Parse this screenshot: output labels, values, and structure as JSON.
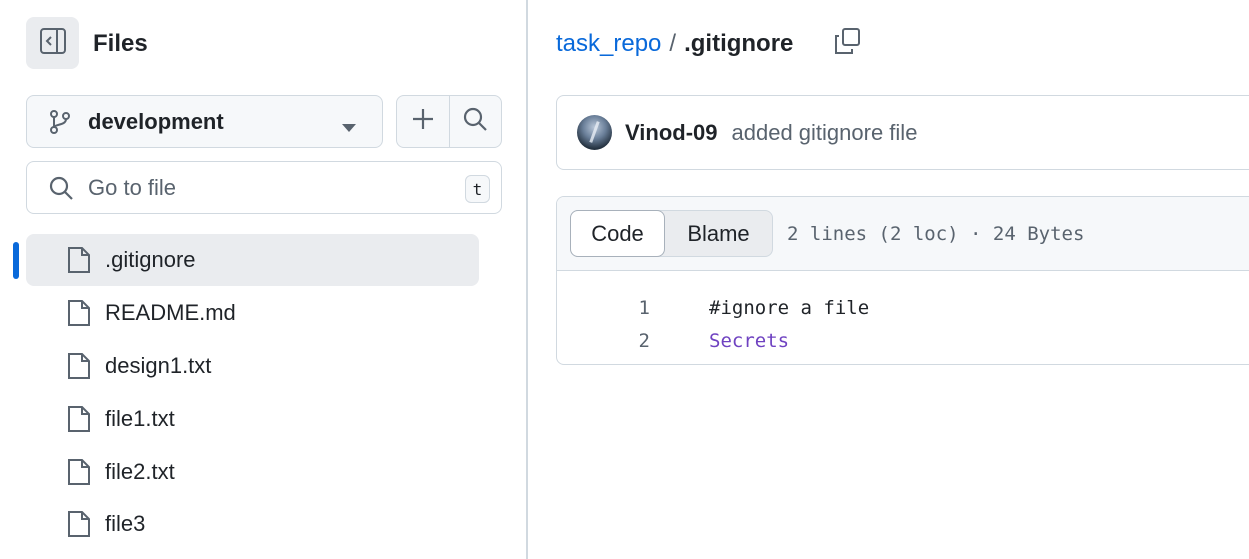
{
  "sidebar": {
    "title": "Files",
    "branch": "development",
    "search": {
      "placeholder": "Go to file",
      "shortcut": "t"
    },
    "files": [
      {
        "name": ".gitignore",
        "active": true
      },
      {
        "name": "README.md"
      },
      {
        "name": "design1.txt"
      },
      {
        "name": "file1.txt"
      },
      {
        "name": "file2.txt"
      },
      {
        "name": "file3"
      }
    ]
  },
  "breadcrumb": {
    "repo": "task_repo",
    "separator": "/",
    "file": ".gitignore"
  },
  "commit": {
    "author": "Vinod-09",
    "message": "added gitignore file"
  },
  "viewer": {
    "tabs": {
      "code": "Code",
      "blame": "Blame"
    },
    "meta": "2 lines (2 loc) · 24 Bytes",
    "lines": [
      {
        "num": "1",
        "text": "#ignore a file"
      },
      {
        "num": "2",
        "text": "Secrets"
      }
    ]
  },
  "colors": {
    "accent": "#0969da",
    "selected_bg": "#eaecef",
    "border": "#d1d9e0",
    "muted_text": "#59636e",
    "code_purple": "#6f42c1"
  }
}
